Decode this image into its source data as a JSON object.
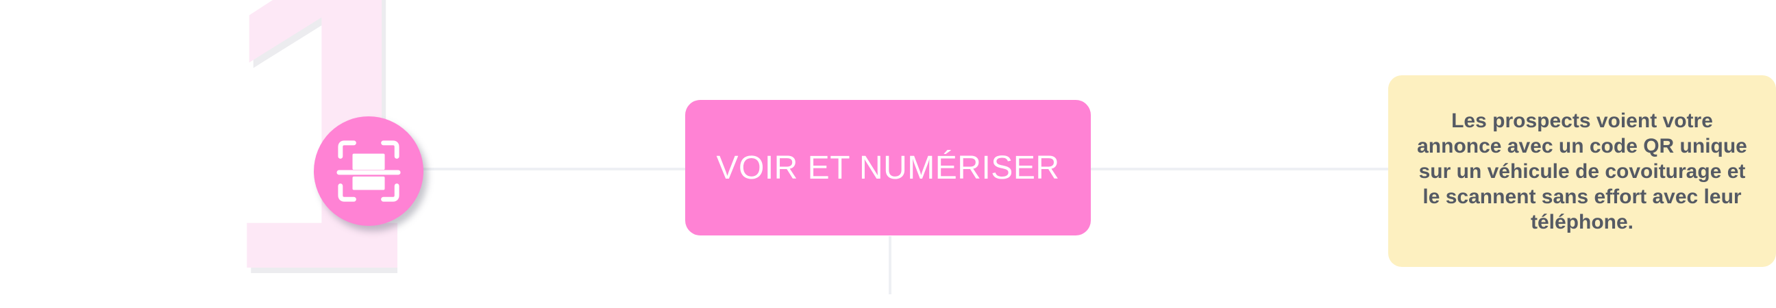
{
  "step": {
    "number": "1",
    "icon": "scan-icon",
    "title": "VOIR ET NUMÉRISER",
    "description": "Les prospects voient votre annonce avec un code QR unique sur un véhicule de covoiturage et le scannent sans effort avec leur téléphone."
  },
  "colors": {
    "accent": "#ff82d4",
    "number_tint": "#fde8f6",
    "card_background": "#fdf0c0",
    "card_text": "#555a64",
    "connector": "#eef0f4"
  }
}
